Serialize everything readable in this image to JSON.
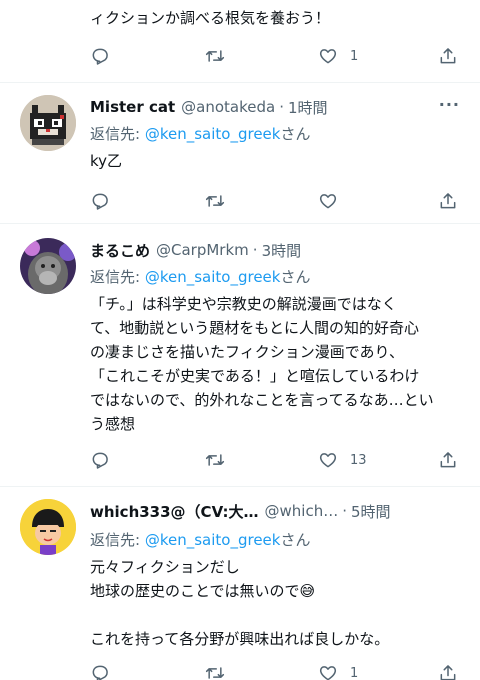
{
  "top_tweet": {
    "text_line": "ィクションか調べる根気を養おう！",
    "likes": "1"
  },
  "tweets": [
    {
      "name": "Mister cat",
      "handle": "@anotakeda",
      "dot": "·",
      "time": "1時間",
      "reply_prefix": "返信先:",
      "mention": "@ken_saito_greek",
      "reply_suffix": "さん",
      "lines": [
        "ky乙"
      ],
      "likes": ""
    },
    {
      "name": "まるこめ",
      "handle": "@CarpMrkm",
      "dot": "·",
      "time": "3時間",
      "reply_prefix": "返信先:",
      "mention": "@ken_saito_greek",
      "reply_suffix": "さん",
      "lines": [
        "「チ。」は科学史や宗教史の解説漫画ではなく",
        "て、地動説という題材をもとに人間の知的好奇心",
        "の凄まじさを描いたフィクション漫画であり、",
        "「これこそが史実である！」と喧伝しているわけ",
        "ではないので、的外れなことを言ってるなあ…とい",
        "う感想"
      ],
      "likes": "13"
    },
    {
      "name": "which333@（CV:大…",
      "handle": "@which…",
      "dot": "·",
      "time": "5時間",
      "reply_prefix": "返信先:",
      "mention": "@ken_saito_greek",
      "reply_suffix": "さん",
      "lines": [
        "元々フィクションだし",
        "地球の歴史のことでは無いので😅",
        "",
        "これを持って各分野が興味出れば良しかな。"
      ],
      "likes": "1"
    }
  ],
  "icons": {
    "reply": "reply-icon",
    "retweet": "retweet-icon",
    "like": "heart-icon",
    "share": "share-icon",
    "more": "more-icon"
  },
  "colors": {
    "link": "#1d9bf0",
    "secondary": "#536471",
    "separator": "#eff3f4"
  }
}
